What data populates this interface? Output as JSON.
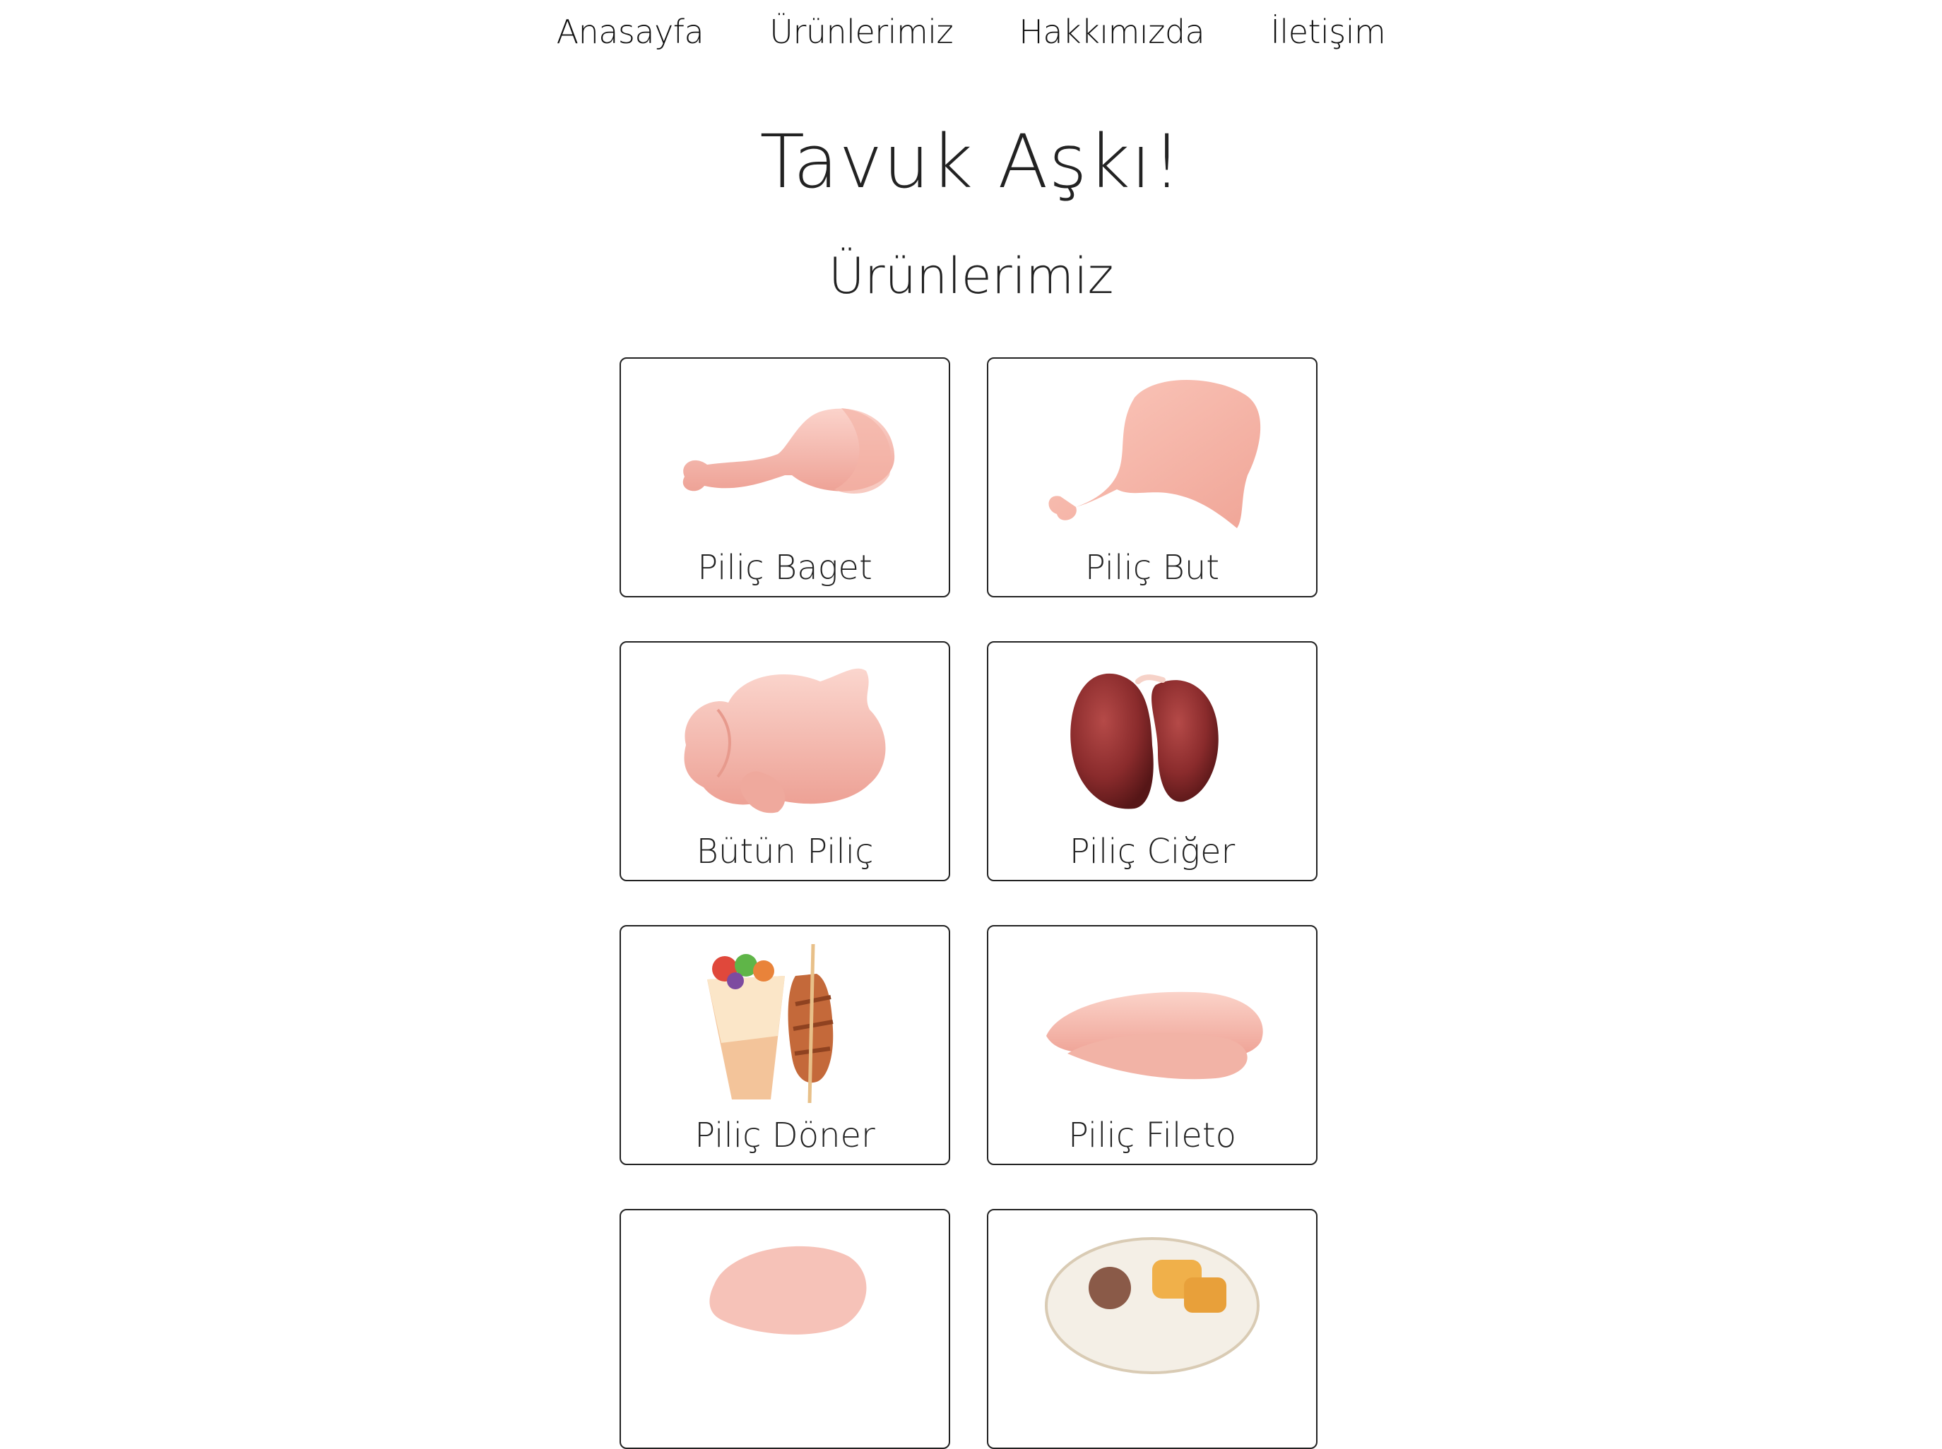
{
  "nav": {
    "items": [
      {
        "label": "Anasayfa"
      },
      {
        "label": "Ürünlerimiz"
      },
      {
        "label": "Hakkımızda"
      },
      {
        "label": "İletişim"
      }
    ]
  },
  "header": {
    "title": "Tavuk Aşkı!"
  },
  "products": {
    "section_title": "Ürünlerimiz",
    "items": [
      {
        "name": "Piliç Baget",
        "icon": "chicken-drumstick-icon"
      },
      {
        "name": "Piliç But",
        "icon": "chicken-leg-quarter-icon"
      },
      {
        "name": "Bütün Piliç",
        "icon": "whole-chicken-icon"
      },
      {
        "name": "Piliç Ciğer",
        "icon": "chicken-liver-icon"
      },
      {
        "name": "Piliç Döner",
        "icon": "doner-wrap-icon"
      },
      {
        "name": "Piliç Fileto",
        "icon": "chicken-fillet-icon"
      },
      {
        "name": "",
        "icon": "chicken-wing-icon"
      },
      {
        "name": "",
        "icon": "nugget-plate-icon"
      }
    ]
  },
  "colors": {
    "raw_meat": "#f6c2b8",
    "raw_meat_shadow": "#e9998c",
    "liver": "#7a2526",
    "border": "#222222"
  }
}
